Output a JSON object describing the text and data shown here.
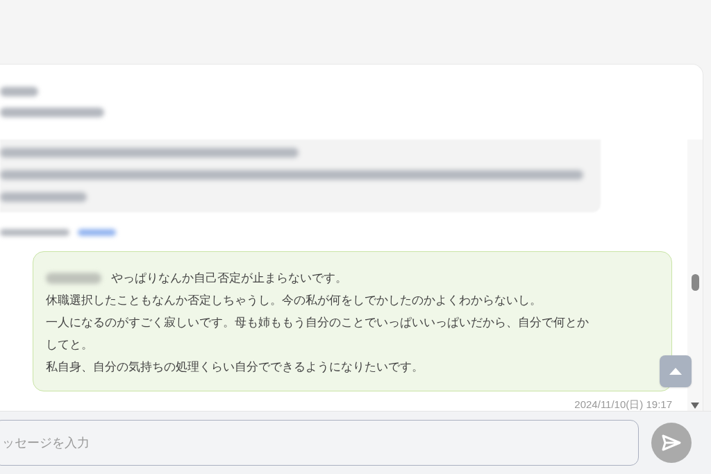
{
  "messages": [
    {
      "kind": "received_blurred"
    },
    {
      "kind": "sent",
      "name_blurred": true,
      "lines": [
        "やっぱりなんか自己否定が止まらないです。",
        "休職選択したこともなんか否定しちゃうし。今の私が何をしでかしたのかよくわからないし。",
        "一人になるのがすごく寂しいです。母も姉ももう自分のことでいっぱいいっぱいだから、自分で何とか",
        "してと。",
        "私自身、自分の気持ちの処理くらい自分でできるようになりたいです。"
      ],
      "timestamp": "2024/11/10(日) 19:17"
    }
  ],
  "composer": {
    "placeholder": "ッセージを入力"
  }
}
